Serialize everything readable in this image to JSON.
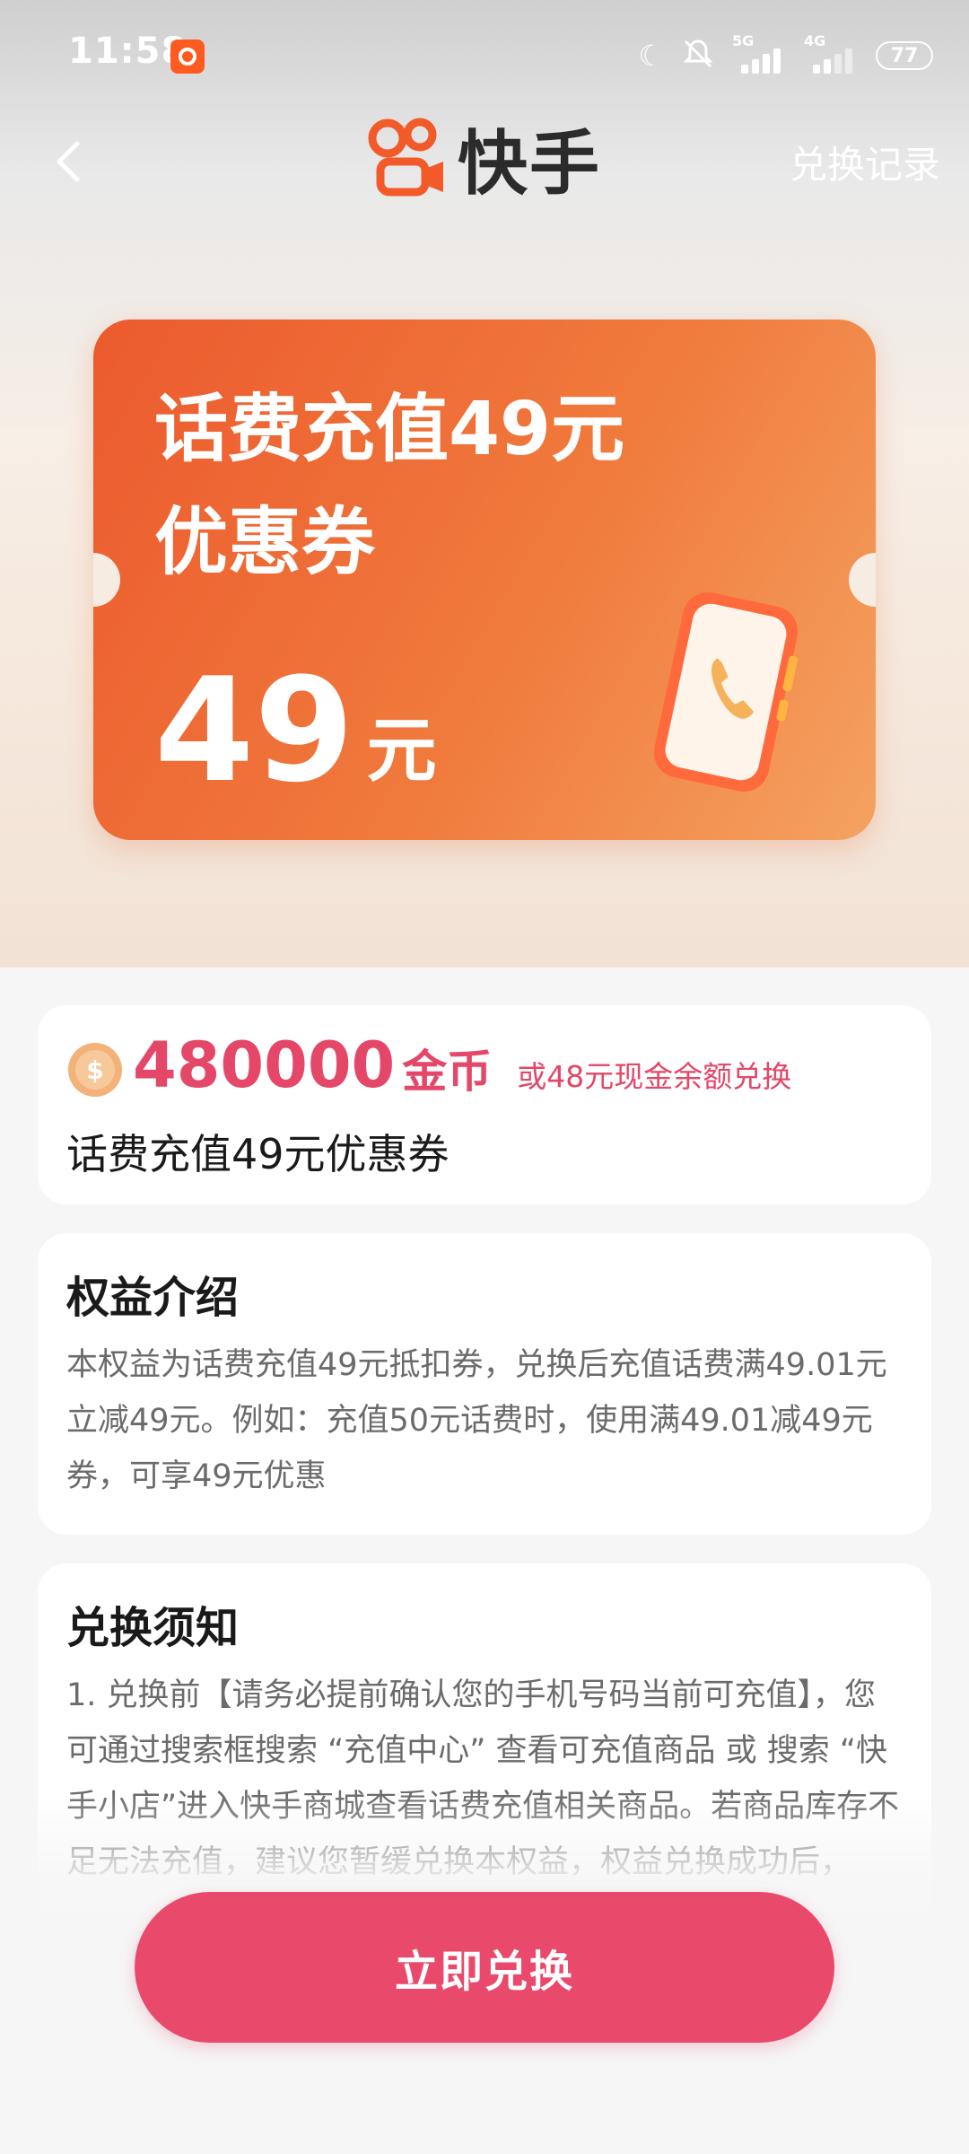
{
  "status_bar": {
    "time": "11:58",
    "network_1": "5G",
    "network_2": "4G",
    "battery": "77"
  },
  "nav": {
    "brand_name": "快手",
    "history_label": "兑换记录"
  },
  "coupon": {
    "title": "话费充值49元优惠券",
    "amount": "49",
    "unit": "元"
  },
  "price": {
    "coins": "480000",
    "coins_unit": "金币",
    "alt_text": "或48元现金余额兑换",
    "name": "话费充值49元优惠券"
  },
  "intro": {
    "title": "权益介绍",
    "body": "本权益为话费充值49元抵扣券，兑换后充值话费满49.01元立减49元。例如：充值50元话费时，使用满49.01减49元券，可享49元优惠"
  },
  "notice": {
    "title": "兑换须知",
    "body": "1. 兑换前【请务必提前确认您的手机号码当前可充值】，您可通过搜索框搜索 “充值中心” 查看可充值商品 或 搜索 “快手小店”进入快手商城查看话费充值相关商品。若商品库存不足无法充值，建议您暂缓兑换本权益，权益兑换成功后，"
  },
  "cta": {
    "label": "立即兑换"
  },
  "colors": {
    "accent": "#e94a6c",
    "coupon_start": "#ec5a2e",
    "coupon_end": "#f4a261"
  }
}
